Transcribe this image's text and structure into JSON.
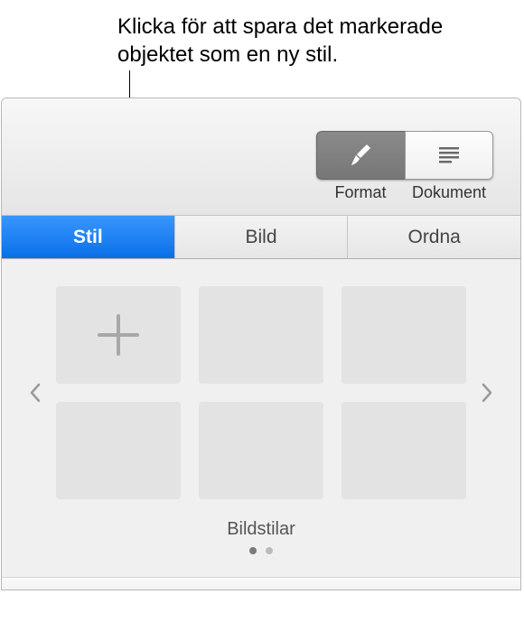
{
  "callout": {
    "text": "Klicka för att spara det markerade objektet som en ny stil."
  },
  "toolbar": {
    "format_label": "Format",
    "document_label": "Dokument"
  },
  "tabs": {
    "stil": "Stil",
    "bild": "Bild",
    "ordna": "Ordna"
  },
  "styles_panel": {
    "label": "Bildstilar"
  }
}
